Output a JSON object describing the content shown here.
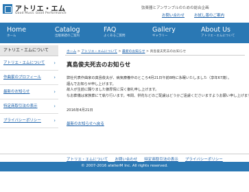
{
  "header": {
    "logo_title": "アトリエ・エム",
    "logo_subtitle": "Good Music Good Performance",
    "tagline": "弦楽器とアンサンブルのための総合企画",
    "top_links": [
      "お問い合わせ",
      "お試し版のご案内"
    ]
  },
  "nav": [
    {
      "en": "Home",
      "jp": "ホーム"
    },
    {
      "en": "Catalog",
      "jp": "出版楽譜のご案内"
    },
    {
      "en": "FAQ",
      "jp": "よくあるご質問"
    },
    {
      "en": "Gallery",
      "jp": "ギャラリー"
    },
    {
      "en": "About Us",
      "jp": "アトリエ・エムについて"
    }
  ],
  "sidebar": {
    "heading": "アトリエ・エムについて",
    "items": [
      {
        "label": "アトリエ・エムについて"
      },
      {
        "label": "作曲家のプロフィール"
      },
      {
        "label": "最新のお知らせ"
      },
      {
        "label": "特定商取引法の表示"
      },
      {
        "label": "プライバシーポリシー"
      }
    ]
  },
  "breadcrumb": {
    "home": "ホーム",
    "about": "アトリエ・エムについて",
    "news": "最新のお知らせ",
    "current": "真島俊夫死去のお知らせ"
  },
  "article": {
    "title": "真島俊夫死去のお知らせ",
    "paragraphs": [
      "弊社代表作曲家の真島俊夫が、病気療養中のところ4月21日午前8時に永眠いたしました（享年67歳）。",
      "謹んでお知らせ申し上げます。",
      "故人が生前に賜りました御厚情に深く御礼申し上げます。",
      "なお葬儀は家族葬にて執り行います。弔問、供花などのご配慮はどうかご遠慮くださいますようお願い申し上げます。"
    ],
    "date": "2016年4月21日",
    "back_link": "最新のお知らせへ戻る"
  },
  "footer": {
    "links": [
      "アトリエ・エムについて",
      "お問い合わせ",
      "特定商取引法の表示",
      "プライバシーポリシー"
    ],
    "copyright": "© 2007-2016 atelierM Inc. All rights reserved."
  }
}
